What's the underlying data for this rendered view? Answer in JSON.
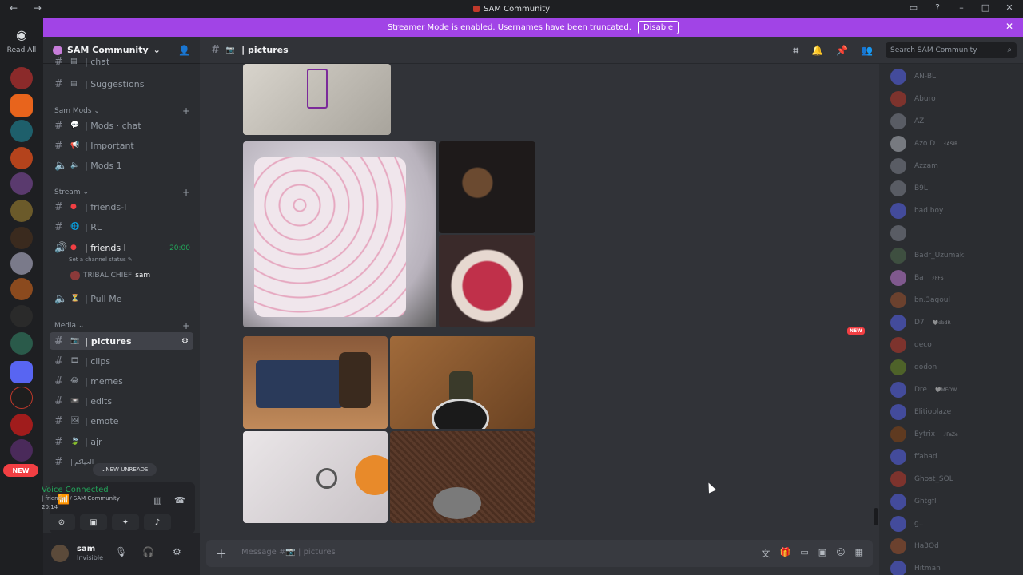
{
  "window": {
    "title": "SAM Community",
    "nav_arrows": "← →"
  },
  "banner": {
    "text": "Streamer Mode is enabled. Usernames have been truncated.",
    "button": "Disable"
  },
  "guilds": {
    "read_all": "Read All",
    "new_label": "NEW"
  },
  "server": {
    "name": "SAM Community"
  },
  "categories": {
    "sam_mods": "Sam Mods",
    "stream": "Stream",
    "media": "Media"
  },
  "channels": {
    "chat_top": "| chat",
    "suggestions": "| Suggestions",
    "mods_chat": "| Mods · chat",
    "important": "| Important",
    "mods1": "| Mods 1",
    "friends_i_1": "| friends-I",
    "rl": "| RL",
    "friends_i_voice": "| friends I",
    "friends_i_time": "20:00",
    "channel_status": "Set a channel status",
    "voice_user": "TRIBAL CHIEF",
    "voice_user_tag": "sam",
    "pull_me": "| Pull Me",
    "pictures": "| pictures",
    "clips": "| clips",
    "memes": "| memes",
    "edits": "| edits",
    "emote": "| emote",
    "ajr": "| ajr",
    "arabic": "| الحياكم"
  },
  "new_unreads": "NEW UNREADS",
  "voice": {
    "status": "Voice Connected",
    "channel": "| friends I / SAM Community",
    "elapsed": "20:14"
  },
  "user": {
    "name": "sam",
    "status": "Invisible"
  },
  "header": {
    "channel": "| pictures"
  },
  "search": {
    "placeholder": "Search SAM Community"
  },
  "new_tag": "NEW",
  "composer": {
    "placeholder": "Message #📷 | pictures"
  },
  "members": [
    {
      "name": "AN-BL",
      "tag": "",
      "color": "#5865f2"
    },
    {
      "name": "Aburo",
      "tag": "",
      "color": "#c0392b"
    },
    {
      "name": "AZ",
      "tag": "",
      "color": "#80848e"
    },
    {
      "name": "Azo D",
      "tag": "⚡ASIR",
      "color": "#b5bac1"
    },
    {
      "name": "Azzam",
      "tag": "",
      "color": "#80848e"
    },
    {
      "name": "B9L",
      "tag": "",
      "color": "#80848e"
    },
    {
      "name": "bad boy",
      "tag": "",
      "color": "#5865f2"
    },
    {
      "name": "",
      "tag": "",
      "color": "#80848e"
    },
    {
      "name": "Badr_Uzumaki",
      "tag": "",
      "color": "#4e6b4e"
    },
    {
      "name": "Ba",
      "tag": "⚡FFST",
      "color": "#c77dda"
    },
    {
      "name": "bn.3agoul",
      "tag": "",
      "color": "#a0522d"
    },
    {
      "name": "D7",
      "tag": "🤍dbdR",
      "color": "#5865f2"
    },
    {
      "name": "deco",
      "tag": "",
      "color": "#c0392b"
    },
    {
      "name": "dodon",
      "tag": "",
      "color": "#6b8e23"
    },
    {
      "name": "Dre",
      "tag": "🤍MEOW",
      "color": "#5865f2"
    },
    {
      "name": "Elitioblaze",
      "tag": "",
      "color": "#5865f2"
    },
    {
      "name": "Eytrix",
      "tag": "⚡FaZe",
      "color": "#8b4513"
    },
    {
      "name": "ffahad",
      "tag": "",
      "color": "#5865f2"
    },
    {
      "name": "Ghost_SOL",
      "tag": "",
      "color": "#c0392b"
    },
    {
      "name": "Ghtgfl",
      "tag": "",
      "color": "#5865f2"
    },
    {
      "name": "g..",
      "tag": "",
      "color": "#5865f2"
    },
    {
      "name": "Ha3Od",
      "tag": "",
      "color": "#a0522d"
    },
    {
      "name": "Hitman",
      "tag": "",
      "color": "#5865f2"
    }
  ]
}
